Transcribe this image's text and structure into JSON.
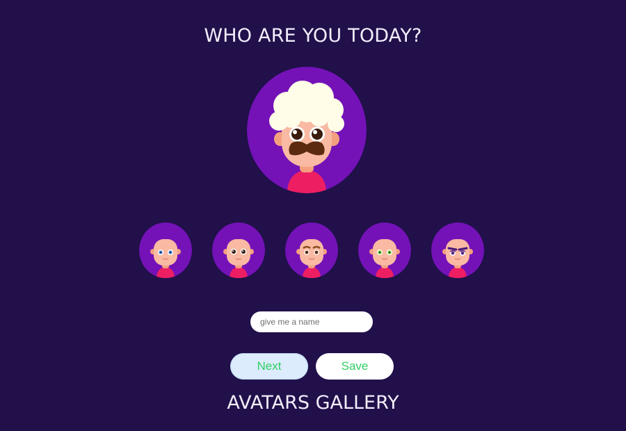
{
  "header": {
    "title": "WHO ARE YOU TODAY?"
  },
  "avatar_preview": {
    "icon": "avatar-icon",
    "hair": "curly-blonde",
    "eyes": "large-brown",
    "mustache": true
  },
  "avatar_options": [
    {
      "icon": "avatar-option-icon",
      "eyes": "blue"
    },
    {
      "icon": "avatar-option-icon",
      "eyes": "wide-dark"
    },
    {
      "icon": "avatar-option-icon",
      "eyes": "brown-browed"
    },
    {
      "icon": "avatar-option-icon",
      "eyes": "green"
    },
    {
      "icon": "avatar-option-icon",
      "eyes": "purple-lidded"
    }
  ],
  "name_input": {
    "placeholder": "give me a name",
    "value": ""
  },
  "buttons": {
    "next_label": "Next",
    "save_label": "Save"
  },
  "gallery": {
    "title": "AVATARS GALLERY"
  },
  "colors": {
    "background": "#21104a",
    "avatar_bg": "#7412b8",
    "skin": "#f9b9a2",
    "shirt": "#ee1e63",
    "button_text": "#2fcf63",
    "hair": "#fffde8",
    "mustache": "#5c2a0f"
  }
}
